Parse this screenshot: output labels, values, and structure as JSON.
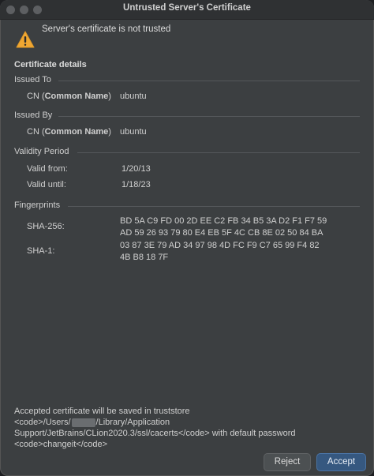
{
  "window": {
    "title": "Untrusted Server's Certificate"
  },
  "warning": {
    "icon": "warning-triangle-icon",
    "text": "Server's certificate is not trusted"
  },
  "details": {
    "heading": "Certificate details",
    "issued_to": {
      "label": "Issued To",
      "cn_prefix": "CN (",
      "cn_bold": "Common Name",
      "cn_suffix": ")",
      "value": "ubuntu"
    },
    "issued_by": {
      "label": "Issued By",
      "cn_prefix": "CN (",
      "cn_bold": "Common Name",
      "cn_suffix": ")",
      "value": "ubuntu"
    },
    "validity": {
      "label": "Validity Period",
      "from_label": "Valid from:",
      "from_value": "1/20/13",
      "until_label": "Valid until:",
      "until_value": "1/18/23"
    },
    "fingerprints": {
      "label": "Fingerprints",
      "sha256_label": "SHA-256:",
      "sha256_line1": "BD 5A C9 FD 00 2D EE C2 FB 34 B5 3A D2 F1 F7 59",
      "sha256_line2": "AD 59 26 93 79 80 E4 EB 5F 4C CB 8E 02 50 84 BA",
      "sha1_label": "SHA-1:",
      "sha1_line1": "03 87 3E 79 AD 34 97 98 4D FC F9 C7 65 99 F4 82",
      "sha1_line2": "4B B8 18 7F"
    }
  },
  "footer": {
    "line1": "Accepted certificate will be saved in truststore",
    "line2_before": "<code>/Users/",
    "line2_after": "/Library/Application",
    "line3": "Support/JetBrains/CLion2020.3/ssl/cacerts</code> with default password",
    "line4": "<code>changeit</code>"
  },
  "buttons": {
    "reject": "Reject",
    "accept": "Accept"
  },
  "colors": {
    "accent": "#365880",
    "warning": "#f0a732"
  }
}
